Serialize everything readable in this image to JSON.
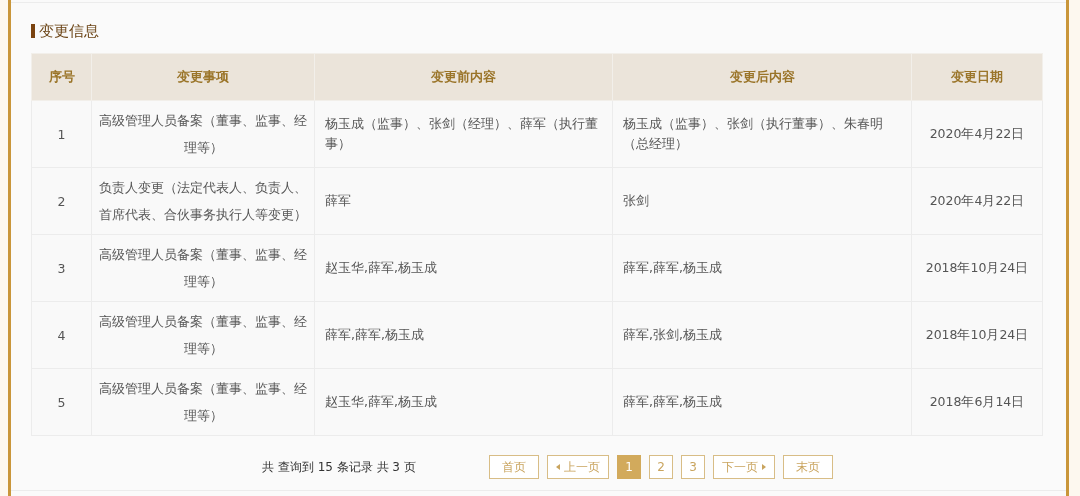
{
  "section_title": "变更信息",
  "table": {
    "columns": [
      "序号",
      "变更事项",
      "变更前内容",
      "变更后内容",
      "变更日期"
    ],
    "rows": [
      {
        "no": "1",
        "item": "高级管理人员备案（董事、监事、经理等）",
        "before": "杨玉成（监事）、张剑（经理）、薛军（执行董事）",
        "after": "杨玉成（监事）、张剑（执行董事）、朱春明（总经理）",
        "date": "2020年4月22日"
      },
      {
        "no": "2",
        "item": "负责人变更（法定代表人、负责人、首席代表、合伙事务执行人等变更）",
        "before": "薛军",
        "after": "张剑",
        "date": "2020年4月22日"
      },
      {
        "no": "3",
        "item": "高级管理人员备案（董事、监事、经理等）",
        "before": "赵玉华,薛军,杨玉成",
        "after": "薛军,薛军,杨玉成",
        "date": "2018年10月24日"
      },
      {
        "no": "4",
        "item": "高级管理人员备案（董事、监事、经理等）",
        "before": "薛军,薛军,杨玉成",
        "after": "薛军,张剑,杨玉成",
        "date": "2018年10月24日"
      },
      {
        "no": "5",
        "item": "高级管理人员备案（董事、监事、经理等）",
        "before": "赵玉华,薛军,杨玉成",
        "after": "薛军,薛军,杨玉成",
        "date": "2018年6月14日"
      }
    ]
  },
  "pagination": {
    "summary": "共 查询到 15 条记录 共 3 页",
    "buttons": [
      {
        "kind": "text",
        "label": "首页"
      },
      {
        "kind": "prev",
        "label": "上一页"
      },
      {
        "kind": "page",
        "label": "1",
        "selected": true
      },
      {
        "kind": "page",
        "label": "2",
        "selected": false
      },
      {
        "kind": "page",
        "label": "3",
        "selected": false
      },
      {
        "kind": "next",
        "label": "下一页"
      },
      {
        "kind": "text",
        "label": "末页"
      }
    ]
  }
}
